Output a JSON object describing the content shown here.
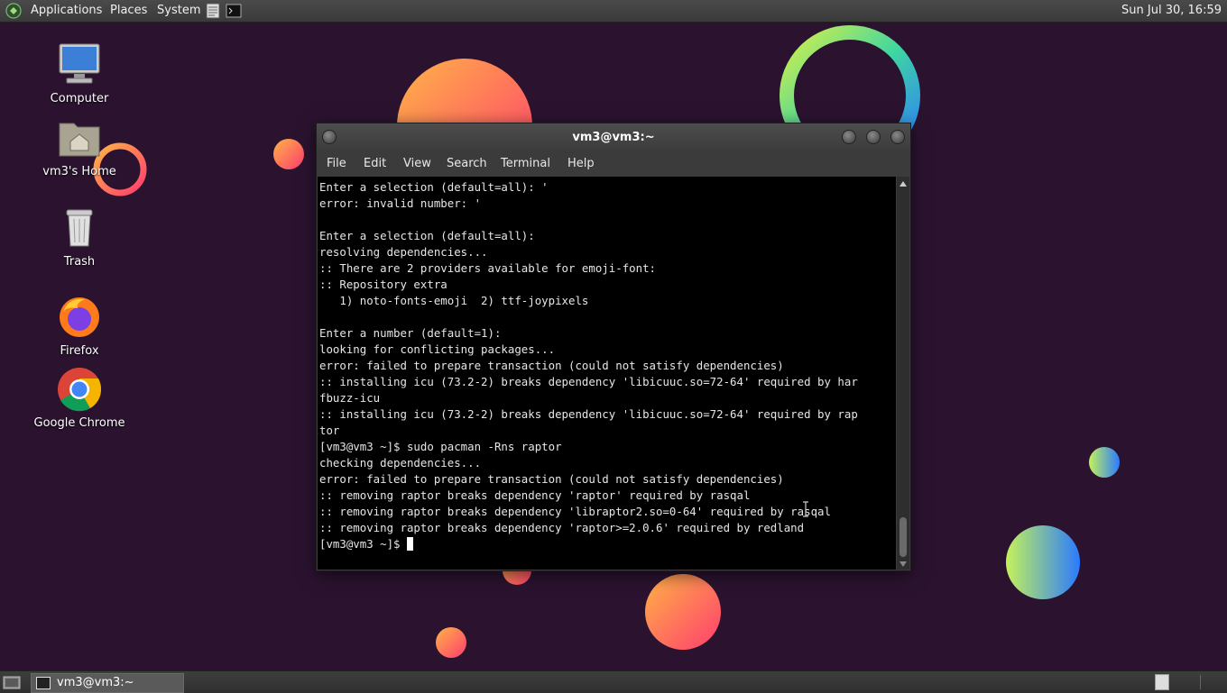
{
  "top_panel": {
    "menus": [
      "Applications",
      "Places",
      "System"
    ],
    "clock": "Sun Jul 30, 16:59"
  },
  "desktop_icons": [
    {
      "label": "Computer"
    },
    {
      "label": "vm3's Home"
    },
    {
      "label": "Trash"
    },
    {
      "label": "Firefox"
    },
    {
      "label": "Google Chrome"
    }
  ],
  "terminal": {
    "title": "vm3@vm3:~",
    "menu": [
      "File",
      "Edit",
      "View",
      "Search",
      "Terminal",
      "Help"
    ],
    "lines": [
      "Enter a selection (default=all): '",
      "error: invalid number: '",
      "",
      "Enter a selection (default=all):",
      "resolving dependencies...",
      ":: There are 2 providers available for emoji-font:",
      ":: Repository extra",
      "   1) noto-fonts-emoji  2) ttf-joypixels",
      "",
      "Enter a number (default=1):",
      "looking for conflicting packages...",
      "error: failed to prepare transaction (could not satisfy dependencies)",
      ":: installing icu (73.2-2) breaks dependency 'libicuuc.so=72-64' required by har",
      "fbuzz-icu",
      ":: installing icu (73.2-2) breaks dependency 'libicuuc.so=72-64' required by rap",
      "tor",
      "[vm3@vm3 ~]$ sudo pacman -Rns raptor",
      "checking dependencies...",
      "error: failed to prepare transaction (could not satisfy dependencies)",
      ":: removing raptor breaks dependency 'raptor' required by rasqal",
      ":: removing raptor breaks dependency 'libraptor2.so=0-64' required by rasqal",
      ":: removing raptor breaks dependency 'raptor>=2.0.6' required by redland"
    ],
    "prompt": "[vm3@vm3 ~]$ "
  },
  "taskbar": {
    "task_label": "vm3@vm3:~"
  },
  "colors": {
    "desktop_bg": "#2b1330",
    "panel": "#3e3e3e",
    "terminal_bg": "#000000",
    "terminal_fg": "#e6e6e6"
  },
  "icons": {
    "os_logo": "distro-logo-icon",
    "launcher_1": "text-editor-icon",
    "launcher_2": "terminal-icon",
    "show_desktop": "show-desktop-icon"
  }
}
